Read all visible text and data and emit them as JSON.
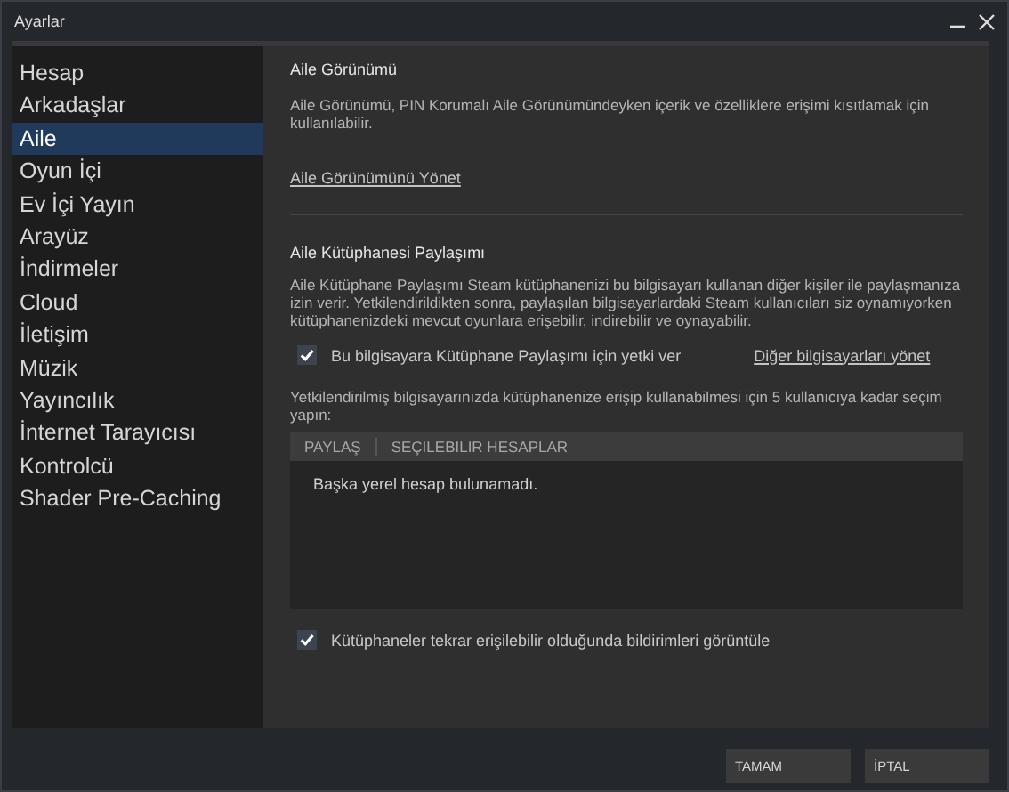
{
  "window": {
    "title": "Ayarlar"
  },
  "sidebar": {
    "items": [
      {
        "label": "Hesap",
        "selected": false
      },
      {
        "label": "Arkadaşlar",
        "selected": false
      },
      {
        "label": "Aile",
        "selected": true
      },
      {
        "label": "Oyun İçi",
        "selected": false
      },
      {
        "label": "Ev İçi Yayın",
        "selected": false
      },
      {
        "label": "Arayüz",
        "selected": false
      },
      {
        "label": "İndirmeler",
        "selected": false
      },
      {
        "label": "Cloud",
        "selected": false
      },
      {
        "label": "İletişim",
        "selected": false
      },
      {
        "label": "Müzik",
        "selected": false
      },
      {
        "label": "Yayıncılık",
        "selected": false
      },
      {
        "label": "İnternet Tarayıcısı",
        "selected": false
      },
      {
        "label": "Kontrolcü",
        "selected": false
      },
      {
        "label": "Shader Pre-Caching",
        "selected": false
      }
    ]
  },
  "family_view": {
    "heading": "Aile Görünümü",
    "description": "Aile Görünümü, PIN Korumalı Aile Görünümündeyken içerik ve özelliklere erişimi kısıtlamak için kullanılabilir.",
    "link": "Aile Görünümünü Yönet"
  },
  "library_sharing": {
    "heading": "Aile Kütüphanesi Paylaşımı",
    "description": "Aile Kütüphane Paylaşımı Steam kütüphanenizi bu bilgisayarı kullanan diğer kişiler ile paylaşmanıza izin verir. Yetkilendirildikten sonra, paylaşılan bilgisayarlardaki Steam kullanıcıları siz oynamıyorken kütüphanenizdeki mevcut oyunlara erişebilir, indirebilir ve oynayabilir.",
    "authorize": {
      "label": "Bu bilgisayara Kütüphane Paylaşımı için yetki ver",
      "checked": true
    },
    "manage_link": "Diğer bilgisayarları yönet",
    "instruction": "Yetkilendirilmiş bilgisayarınızda kütüphanenize erişip kullanabilmesi için 5 kullanıcıya kadar seçim yapın:",
    "table": {
      "columns": [
        "PAYLAŞ",
        "SEÇILEBILIR HESAPLAR"
      ],
      "empty_message": "Başka yerel hesap bulunamadı."
    },
    "notify": {
      "label": "Kütüphaneler tekrar erişilebilir olduğunda bildirimleri görüntüle",
      "checked": true
    }
  },
  "buttons": [
    "TAMAM",
    "İPTAL"
  ]
}
